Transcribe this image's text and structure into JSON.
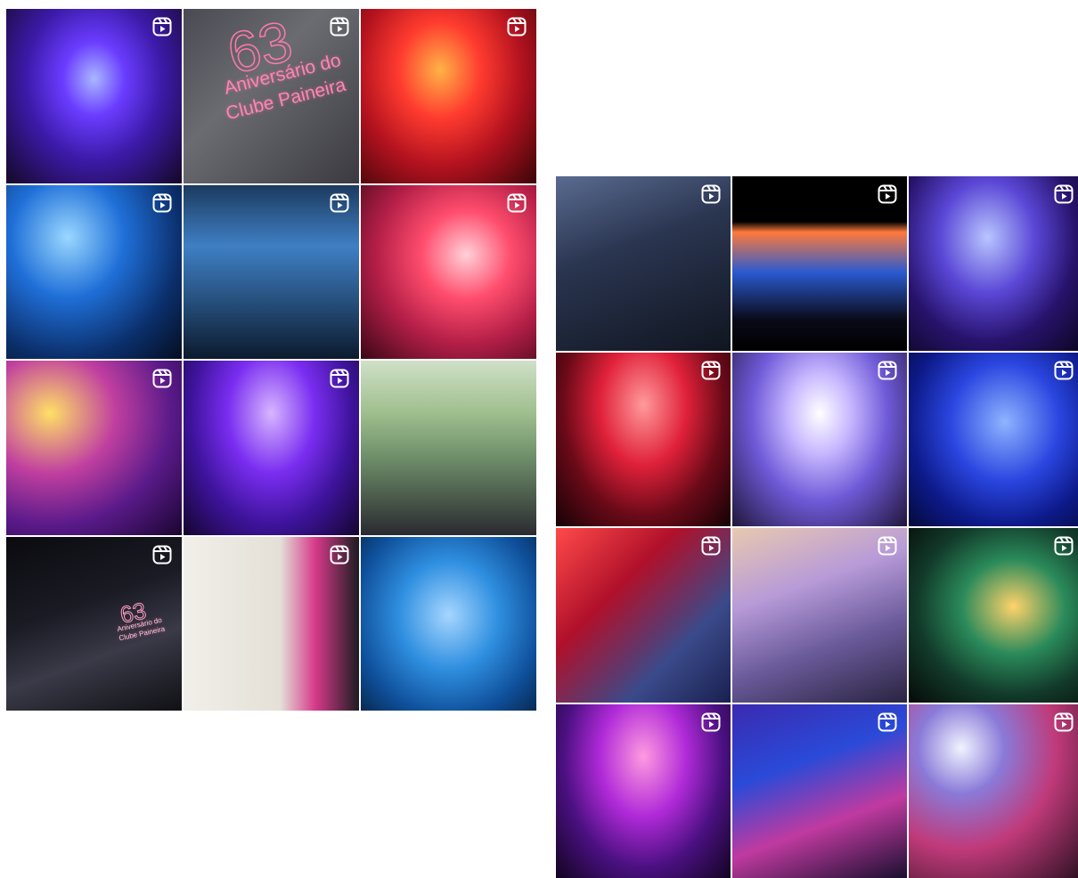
{
  "colors": {
    "background": "#ffffff",
    "reel_icon": "#ffffff"
  },
  "left_grid": {
    "tiles": [
      {
        "name": "concert-stage-purple",
        "icon": "reel-icon",
        "bg": "radial-gradient(ellipse at 50% 40%, #a9b8ff 0%, #6a3cff 25%, #3c1aa8 55%, #140826 100%)"
      },
      {
        "name": "anniversary-card",
        "icon": "reel-icon",
        "bg": "linear-gradient(135deg, #4a4a52 0%, #6b6b72 40%, #3a3a40 100%)",
        "art": {
          "num": "63",
          "line1": "Aniversário do",
          "line2": "Clube Paineira"
        }
      },
      {
        "name": "concert-stage-red",
        "icon": "reel-icon",
        "bg": "radial-gradient(ellipse at 45% 35%, #ffb347 0%, #ff3b2f 30%, #b3121f 60%, #3a0508 100%)"
      },
      {
        "name": "singer-blue-stage",
        "icon": "reel-icon",
        "bg": "radial-gradient(ellipse at 35% 30%, #9ad8ff 0%, #1f6fd8 35%, #0b2f6b 70%, #050d20 100%)"
      },
      {
        "name": "singer-leather-pants-blue",
        "icon": "reel-icon",
        "bg": "linear-gradient(180deg, #1c3a5f 0%, #3f7fc4 35%, #2b5a8c 60%, #0c1a2e 100%)"
      },
      {
        "name": "singer-pink-stage",
        "icon": "reel-icon",
        "bg": "radial-gradient(ellipse at 60% 40%, #ffd1d8 0%, #ff4d6d 30%, #b51f48 60%, #3a0716 100%)"
      },
      {
        "name": "singer-purple-yellow-lights",
        "icon": "reel-icon",
        "bg": "radial-gradient(ellipse at 25% 30%, #ffe066 0%, #c03fa0 35%, #5a1a8a 65%, #1a0530 100%)"
      },
      {
        "name": "singer-purple-stage",
        "icon": "reel-icon",
        "bg": "radial-gradient(ellipse at 50% 30%, #d7b6ff 0%, #7a2df0 35%, #3d139a 65%, #14052e 100%)"
      },
      {
        "name": "men-in-suits-group",
        "icon": "",
        "bg": "linear-gradient(180deg, #cfe0c7 0%, #9fbf8e 30%, #6f8f6a 55%, #2a2a30 100%)"
      },
      {
        "name": "speaker-at-podium",
        "icon": "reel-icon",
        "bg": "linear-gradient(160deg, #0a0a0f 0%, #1b1b25 40%, #3a3a48 65%, #101015 100%)",
        "art": {
          "num": "63",
          "line1": "Aniversário do",
          "line2": "Clube Paineira"
        }
      },
      {
        "name": "white-cake-orchids",
        "icon": "reel-icon",
        "bg": "linear-gradient(90deg, #f1efe9 0%, #e4e0d7 55%, #d63a8a 75%, #1c1c22 100%)"
      },
      {
        "name": "water-polo-team-pool",
        "icon": "",
        "bg": "radial-gradient(ellipse at 50% 45%, #a6d6ff 0%, #2f8fe0 40%, #0f4f9a 75%, #082a52 100%)"
      }
    ]
  },
  "right_grid": {
    "tiles": [
      {
        "name": "band-singer-dark-stage",
        "icon": "reel-icon",
        "bg": "linear-gradient(160deg, #5a6b90 0%, #2a3550 40%, #101520 100%)"
      },
      {
        "name": "crowd-wide-stage",
        "icon": "reel-icon",
        "bg": "linear-gradient(180deg, #000000 0%, #000000 26%, #ff7a3a 32%, #2a5ad0 55%, #0a0a18 82%, #000000 100%)"
      },
      {
        "name": "singer-crowd-surf",
        "icon": "reel-icon",
        "bg": "radial-gradient(ellipse at 45% 35%, #b9c6ff 0%, #5a47d6 35%, #27136b 65%, #0b0520 100%)"
      },
      {
        "name": "band-red-lights",
        "icon": "reel-icon",
        "bg": "radial-gradient(ellipse at 50% 30%, #ff9a9a 0%, #e0213a 35%, #6a0a18 65%, #140205 100%)"
      },
      {
        "name": "band-lavender-lights",
        "icon": "reel-icon",
        "bg": "radial-gradient(ellipse at 50% 35%, #ffffff 0%, #c8b8ff 25%, #6f5ad8 55%, #20163a 100%)"
      },
      {
        "name": "band-blue-stage",
        "icon": "reel-icon",
        "bg": "radial-gradient(ellipse at 55% 40%, #8fb4ff 0%, #2a46e0 40%, #0d1a8a 70%, #040a3a 100%)"
      },
      {
        "name": "singer-closeup-red",
        "icon": "reel-icon",
        "bg": "linear-gradient(135deg, #ff4a4a 0%, #b0102a 35%, #3a4a8a 70%, #1a2050 100%)"
      },
      {
        "name": "singer-arms-out",
        "icon": "reel-icon",
        "bg": "linear-gradient(160deg, #e8c9b0 0%, #b79ad8 35%, #6a5a9a 65%, #2a2440 100%)"
      },
      {
        "name": "guitarist-green-stage",
        "icon": "reel-icon",
        "bg": "radial-gradient(ellipse at 60% 45%, #ffd36a 0%, #2a8a5a 35%, #123a2a 65%, #050a08 100%)"
      },
      {
        "name": "guitarist-purple-stage",
        "icon": "reel-icon",
        "bg": "radial-gradient(ellipse at 50% 30%, #ff9ae0 0%, #b02ad8 35%, #4a1080 65%, #120420 100%)"
      },
      {
        "name": "bassist-blue-closeup",
        "icon": "reel-icon",
        "bg": "linear-gradient(160deg, #3a2ab0 0%, #2a4ad8 35%, #c03aa0 65%, #1a1030 100%)"
      },
      {
        "name": "party-tables-balloons",
        "icon": "reel-icon",
        "bg": "radial-gradient(ellipse at 30% 25%, #f0f4ff 0%, #8a7ad8 25%, #c03a7a 55%, #2a1020 100%)"
      }
    ]
  }
}
